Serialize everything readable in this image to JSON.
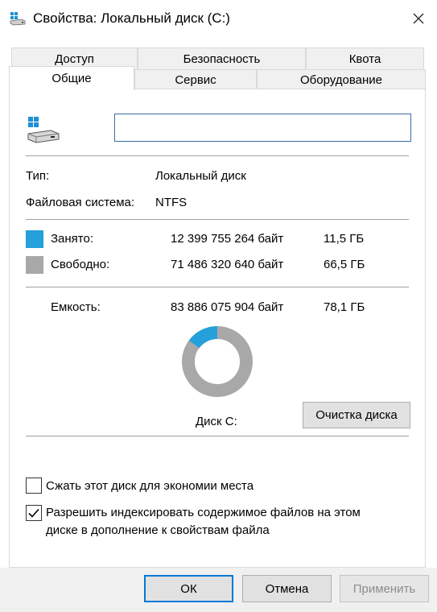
{
  "window": {
    "title": "Свойства: Локальный диск (C:)",
    "icon": "drive-icon",
    "close_icon": "close-icon"
  },
  "tabs": {
    "row1": [
      {
        "label": "Доступ"
      },
      {
        "label": "Безопасность"
      },
      {
        "label": "Квота"
      }
    ],
    "row2": [
      {
        "label": "Общие",
        "active": true
      },
      {
        "label": "Сервис"
      },
      {
        "label": "Оборудование"
      }
    ]
  },
  "general": {
    "drive_name_value": "",
    "type_label": "Тип:",
    "type_value": "Локальный диск",
    "fs_label": "Файловая система:",
    "fs_value": "NTFS",
    "used": {
      "label": "Занято:",
      "bytes": "12 399 755 264 байт",
      "size": "11,5 ГБ",
      "color": "#26a0da"
    },
    "free": {
      "label": "Свободно:",
      "bytes": "71 486 320 640 байт",
      "size": "66,5 ГБ",
      "color": "#a8a8a8"
    },
    "capacity": {
      "label": "Емкость:",
      "bytes": "83 886 075 904 байт",
      "size": "78,1 ГБ"
    },
    "used_fraction": 0.148,
    "disk_label": "Диск C:",
    "cleanup_button": "Очистка диска",
    "compress_checkbox": {
      "label": "Сжать этот диск для экономии места",
      "checked": false
    },
    "index_checkbox": {
      "line1": "Разрешить индексировать содержимое файлов на этом",
      "line2": "диске в дополнение к свойствам файла",
      "checked": true
    }
  },
  "footer": {
    "ok": "ОК",
    "cancel": "Отмена",
    "apply": "Применить"
  }
}
